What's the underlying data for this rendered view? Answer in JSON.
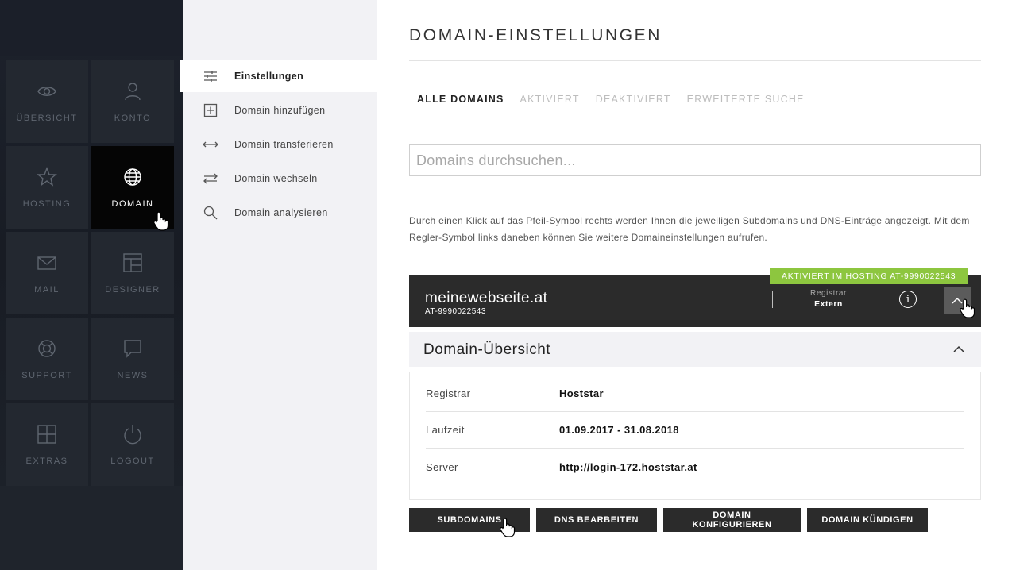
{
  "tiles": [
    {
      "label": "ÜBERSICHT",
      "icon": "eye-icon"
    },
    {
      "label": "KONTO",
      "icon": "user-icon"
    },
    {
      "label": "HOSTING",
      "icon": "star-icon"
    },
    {
      "label": "DOMAIN",
      "icon": "globe-icon"
    },
    {
      "label": "MAIL",
      "icon": "envelope-icon"
    },
    {
      "label": "DESIGNER",
      "icon": "layout-icon"
    },
    {
      "label": "SUPPORT",
      "icon": "lifebuoy-icon"
    },
    {
      "label": "NEWS",
      "icon": "speech-bubble-icon"
    },
    {
      "label": "EXTRAS",
      "icon": "plus-box-icon"
    },
    {
      "label": "LOGOUT",
      "icon": "power-icon"
    }
  ],
  "subnav": {
    "items": [
      {
        "label": "Einstellungen",
        "icon": "sliders-icon"
      },
      {
        "label": "Domain hinzufügen",
        "icon": "plus-box-icon"
      },
      {
        "label": "Domain transferieren",
        "icon": "arrows-horizontal-icon"
      },
      {
        "label": "Domain wechseln",
        "icon": "swap-arrows-icon"
      },
      {
        "label": "Domain analysieren",
        "icon": "magnifier-icon"
      }
    ]
  },
  "main": {
    "title": "DOMAIN-EINSTELLUNGEN",
    "tabs": [
      {
        "label": "ALLE DOMAINS"
      },
      {
        "label": "AKTIVIERT"
      },
      {
        "label": "DEAKTIVIERT"
      },
      {
        "label": "ERWEITERTE SUCHE"
      }
    ],
    "search_placeholder": "Domains durchsuchen...",
    "hint": "Durch einen Klick auf das Pfeil-Symbol rechts werden Ihnen die jeweiligen Subdomains und DNS-Einträge angezeigt. Mit dem Regler-Symbol links daneben können Sie weitere Domaineinstellungen aufrufen."
  },
  "domain": {
    "name": "meinewebseite.at",
    "id": "AT-9990022543",
    "badge": "AKTIVIERT IM HOSTING AT-9990022543",
    "registrar_key": "Registrar",
    "registrar_value": "Extern",
    "info_glyph": "i"
  },
  "overview": {
    "title": "Domain-Übersicht",
    "rows": [
      {
        "key": "Registrar",
        "value": "Hoststar"
      },
      {
        "key": "Laufzeit",
        "value": "01.09.2017 - 31.08.2018"
      },
      {
        "key": "Server",
        "value": "http://login-172.hoststar.at"
      }
    ]
  },
  "actions": [
    {
      "label": "SUBDOMAINS"
    },
    {
      "label": "DNS BEARBEITEN"
    },
    {
      "label": "DOMAIN KONFIGURIEREN"
    },
    {
      "label": "DOMAIN KÜNDIGEN"
    }
  ],
  "colors": {
    "accent_green": "#8dc63f",
    "dark_bar": "#2b2b2b",
    "active_tile": "#050505"
  }
}
